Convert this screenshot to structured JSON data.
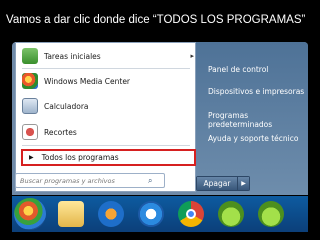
{
  "caption": "Vamos a dar clic donde dice “TODOS LOS PROGRAMAS”",
  "left_menu": {
    "items": [
      {
        "label": "Tareas iniciales",
        "icon": "tasks-icon",
        "has_submenu": true
      },
      {
        "label": "Windows Media Center",
        "icon": "media-center-icon",
        "has_submenu": false
      },
      {
        "label": "Calculadora",
        "icon": "calculator-icon",
        "has_submenu": false
      },
      {
        "label": "Recortes",
        "icon": "snipping-tool-icon",
        "has_submenu": false
      }
    ],
    "all_programs": "Todos los programas"
  },
  "search": {
    "placeholder": "Buscar programas y archivos"
  },
  "right_menu": {
    "items": [
      "Panel de control",
      "Dispositivos e impresoras",
      "Programas predeterminados",
      "Ayuda y soporte técnico"
    ]
  },
  "shutdown": {
    "label": "Apagar"
  },
  "highlight_color": "#d62020",
  "taskbar_icons": [
    "windows-start-icon",
    "folder-icon",
    "media-player-icon",
    "internet-explorer-icon",
    "chrome-icon",
    "app-icon",
    "app-icon"
  ]
}
